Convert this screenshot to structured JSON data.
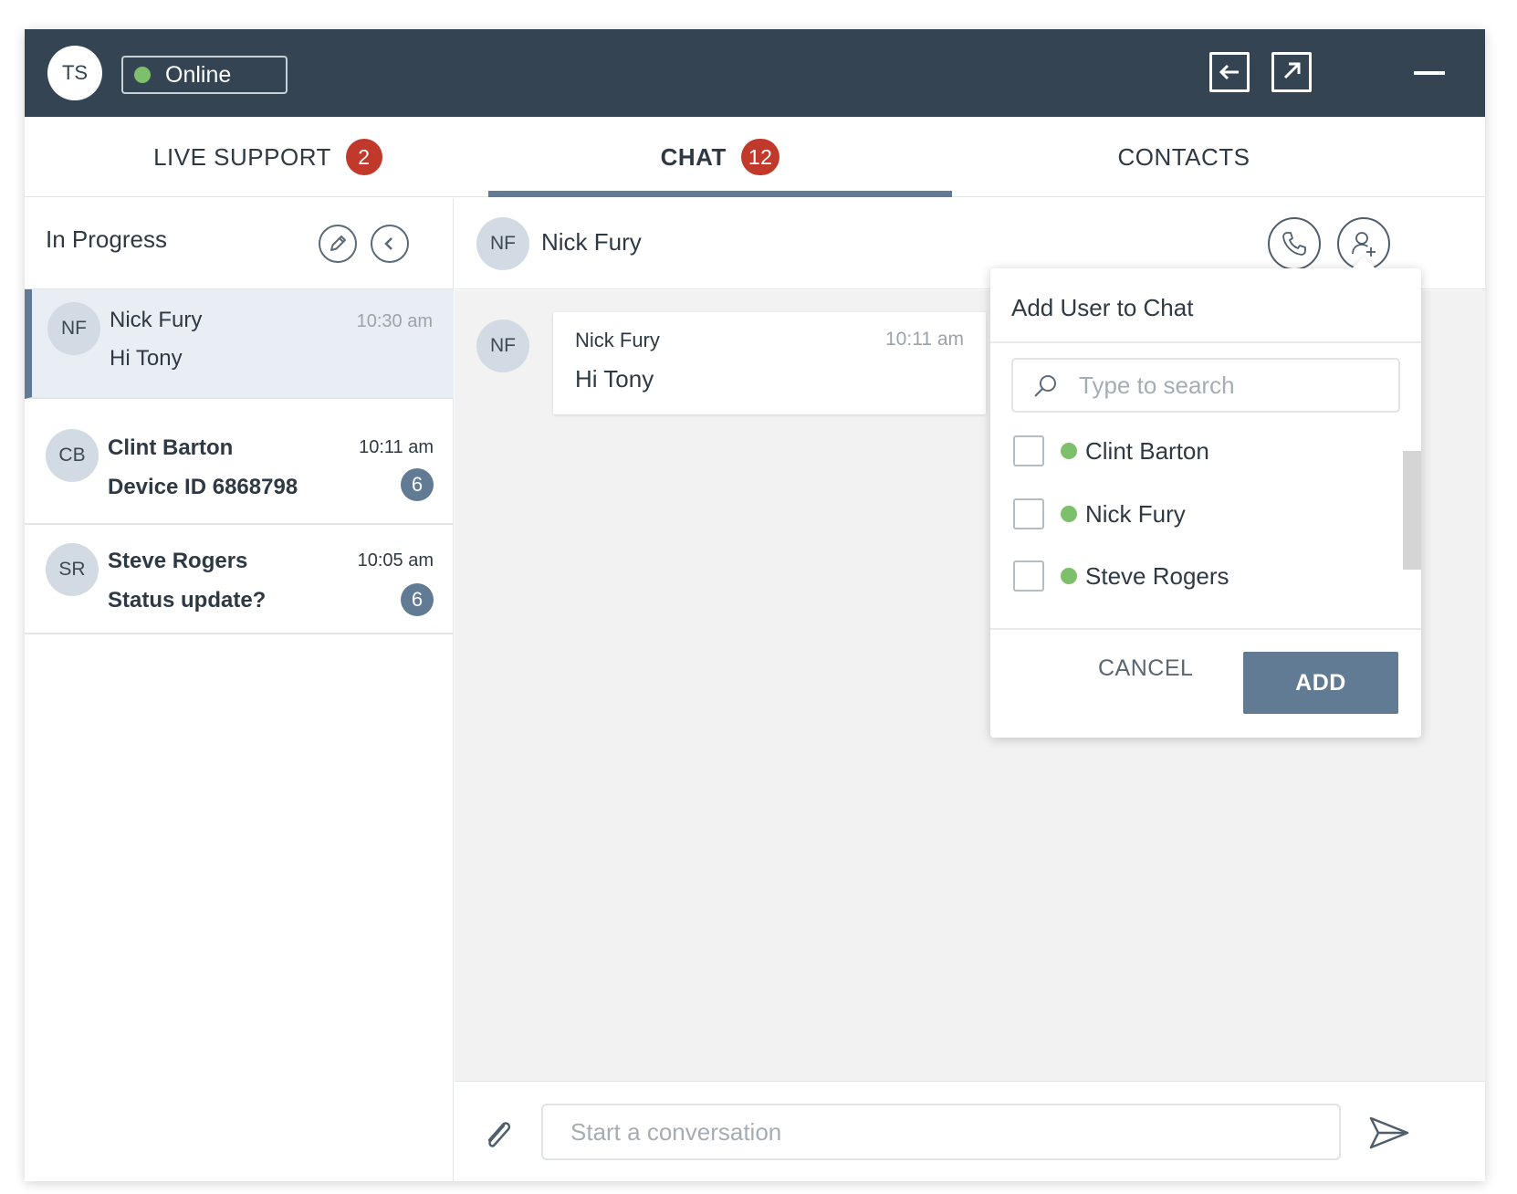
{
  "header": {
    "user_initials": "TS",
    "status_label": "Online",
    "status_color": "#7dbf6b",
    "buttons": [
      "collapse-left-icon",
      "popout-icon",
      "minimize-icon"
    ]
  },
  "tabs": [
    {
      "label": "LIVE SUPPORT",
      "badge": "2",
      "active": false
    },
    {
      "label": "CHAT",
      "badge": "12",
      "active": true
    },
    {
      "label": "CONTACTS",
      "badge": "",
      "active": false
    }
  ],
  "left_panel": {
    "title": "In Progress",
    "conversations": [
      {
        "initials": "NF",
        "name": "Nick Fury",
        "message": "Hi Tony",
        "time": "10:30 am",
        "unread": "",
        "selected": true
      },
      {
        "initials": "CB",
        "name": "Clint Barton",
        "message": "Device ID 6868798",
        "time": "10:11 am",
        "unread": "6",
        "selected": false
      },
      {
        "initials": "SR",
        "name": "Steve Rogers",
        "message": "Status update?",
        "time": "10:05 am",
        "unread": "6",
        "selected": false
      }
    ]
  },
  "chat": {
    "contact_initials": "NF",
    "contact_name": "Nick Fury",
    "messages": [
      {
        "initials": "NF",
        "sender": "Nick Fury",
        "time": "10:11 am",
        "text": "Hi Tony"
      }
    ],
    "composer_placeholder": "Start a conversation"
  },
  "add_user_popover": {
    "title": "Add User to Chat",
    "search_placeholder": "Type to search",
    "users": [
      {
        "name": "Clint Barton",
        "online": true,
        "checked": false
      },
      {
        "name": "Nick Fury",
        "online": true,
        "checked": false
      },
      {
        "name": "Steve Rogers",
        "online": true,
        "checked": false
      }
    ],
    "cancel_label": "CANCEL",
    "add_label": "ADD"
  },
  "colors": {
    "header_bg": "#344453",
    "accent": "#617b94",
    "badge_red": "#c0392b",
    "online_green": "#7dbf6b"
  }
}
